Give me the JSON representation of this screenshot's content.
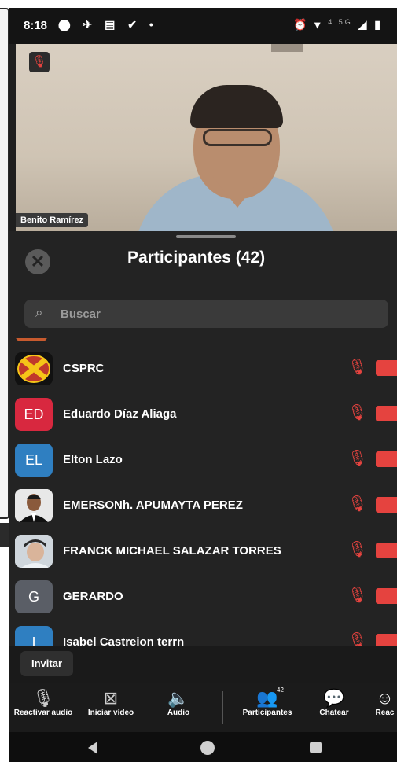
{
  "status_bar": {
    "time": "8:18",
    "left_icons": "⬤ ✈ ▤ ✔ •",
    "right_icons": "⏰ ▾",
    "network": "4.5G"
  },
  "video": {
    "speaker_name": "Benito Ramírez",
    "mute_icon": "mic-off-icon"
  },
  "sheet": {
    "title": "Participantes (42)",
    "search_placeholder": "Buscar",
    "participants": [
      {
        "name": "CSPRC",
        "initials": "",
        "avatar_color": "#111111",
        "avatar_type": "logo"
      },
      {
        "name": "Eduardo Díaz Aliaga",
        "initials": "ED",
        "avatar_color": "#d8283f",
        "avatar_type": "initials"
      },
      {
        "name": "Elton Lazo",
        "initials": "EL",
        "avatar_color": "#2f7fc1",
        "avatar_type": "initials"
      },
      {
        "name": "EMERSONh. APUMAYTA PEREZ",
        "initials": "",
        "avatar_color": "#e8e8e8",
        "avatar_type": "photo"
      },
      {
        "name": "FRANCK MICHAEL SALAZAR TORRES",
        "initials": "",
        "avatar_color": "#cfd6dc",
        "avatar_type": "photo"
      },
      {
        "name": "GERARDO",
        "initials": "G",
        "avatar_color": "#5a5e66",
        "avatar_type": "initials"
      },
      {
        "name": "Isabel Castrejon terrn",
        "initials": "I",
        "avatar_color": "#2f7fc1",
        "avatar_type": "initials"
      }
    ],
    "invite_label": "Invitar"
  },
  "toolbar": {
    "unmute": {
      "label": "Reactivar audio",
      "icon": "mic-off-icon"
    },
    "video": {
      "label": "Iniciar vídeo",
      "icon": "video-off-icon"
    },
    "audio": {
      "label": "Audio",
      "icon": "speaker-icon"
    },
    "participants": {
      "label": "Participantes",
      "icon": "people-icon",
      "count": "42"
    },
    "chat": {
      "label": "Chatear",
      "icon": "chat-icon"
    },
    "react": {
      "label": "Reac",
      "icon": "reaction-icon"
    }
  },
  "colors": {
    "accent_red": "#e5433f",
    "sheet_bg": "#232323"
  }
}
